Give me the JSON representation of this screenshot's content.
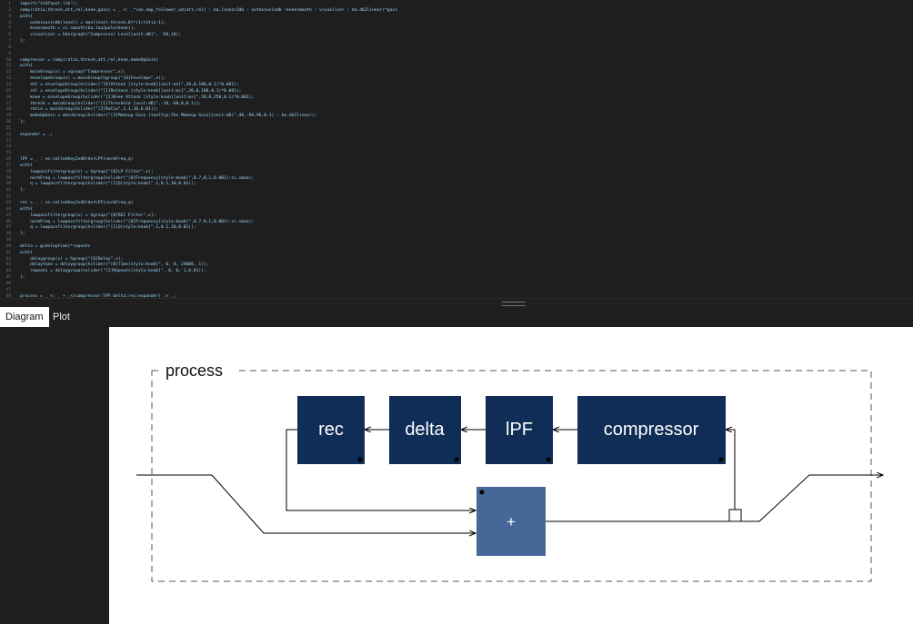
{
  "editor": {
    "code_lines": [
      "import(\"stdfaust.lib\");",
      "comp(ratio,thresh,att,rel,knee,gain) = _ <: _*(an.amp_follower_ud(att,rel) : ba.linear2db : outminusindb :kneesmooth : visualizer : ba.db2linear)*gain",
      "with{",
      "    outminusindb(level) = max(level-thresh,0)*(1/ratio-1);",
      "    kneesmooth = si.smooth(ba.tau2pole(knee));",
      "    visualizer = hbargraph(\"Compressor Level[unit:dB]\", -50,10);",
      "};",
      "",
      "",
      "compressor = comp(ratio,thresh,att,rel,knee,makeUpGain)",
      "with{",
      "    mainGroup(x) = vgroup(\"Compressor\",x);",
      "    envelopeGroup(x) = mainGroup(hgroup(\"[0]Envelope\",x));",
      "    att = envelopeGroup(hslider(\"[0]Attack [style:knob][unit:ms]\",20,0,100,0.1)*0.001);",
      "    rel = envelopeGroup(hslider(\"[1]Release [style:knob][unit:ms]\",20,0,100,0.1)*0.001);",
      "    knee = envelopeGroup(hslider(\"[2]Knee Attack [style:knob][unit:ms]\",20,0,250,0.1)*0.001);",
      "    thresh = mainGroup(hslider(\"[1]Threshold [unit:dB]\",-10,-60,0,0.1));",
      "    ratio = mainGroup(hslider(\"[2]Ratio\",1,1,10,0.01));",
      "    makeUpGain = mainGroup(hslider(\"[3]Makeup Gain [tooltip:The Makeup Gain][unit:dB]\",40,-96,96,0.1) : ba.db2linear);",
      "};",
      "",
      "expander = _;",
      "",
      "",
      "",
      "lPF = _ : ve.sallenKey2ndOrderLPF(normFreq,q)",
      "with{",
      "    lowpassfiltergroup(x) = hgroup(\"[0]LP Filter\",x);",
      "    normFreq = lowpassfiltergroup(hslider(\"[0]Frequency[style:knob]\",0.7,0,1,0.001):si.smoo);",
      "    q = lowpassfiltergroup(hslider(\"[1]Q[style:knob]\",1,0.1,10,0.01));",
      "};",
      "",
      "rec = _ : ve.sallenKey2ndOrderLPF(normFreq,q)",
      "with{",
      "    lowpassfiltergroup(x) = hgroup(\"[0]REC Filter\",x);",
      "    normFreq = lowpassfiltergroup(hslider(\"[0]Frequency[style:knob]\",0.7,0,1,0.001):si.smoo);",
      "    q = lowpassfiltergroup(hslider(\"[1]Q[style:knob]\",1,0.1,10,0.01));",
      "};",
      "",
      "delta = @(delaytime)*repeats",
      "with{",
      "    delaygroup(x) = hgroup(\"[0]Delay\",x);",
      "    delaytime = delaygroup(hslider(\"[0]Time[style:knob]\", 0, 0, 24000, 1));",
      "    repeats = delaygroup(hslider(\"[1]Repeats[style:knob]\", 0, 0, 1,0.01));",
      "};",
      "",
      "",
      "process = _ <: _ + _<(compressor:lPF:delta:rec:expander) :> _;"
    ]
  },
  "tabs": [
    {
      "label": "Diagram",
      "active": true
    },
    {
      "label": "Plot",
      "active": false
    }
  ],
  "diagram": {
    "group_label": "process",
    "blocks": [
      "rec",
      "delta",
      "lPF",
      "compressor"
    ],
    "sum_label": "+",
    "colors": {
      "block": "#0f2d57",
      "sum_block": "#456899",
      "wire": "#000000",
      "group_border": "#555555"
    }
  }
}
